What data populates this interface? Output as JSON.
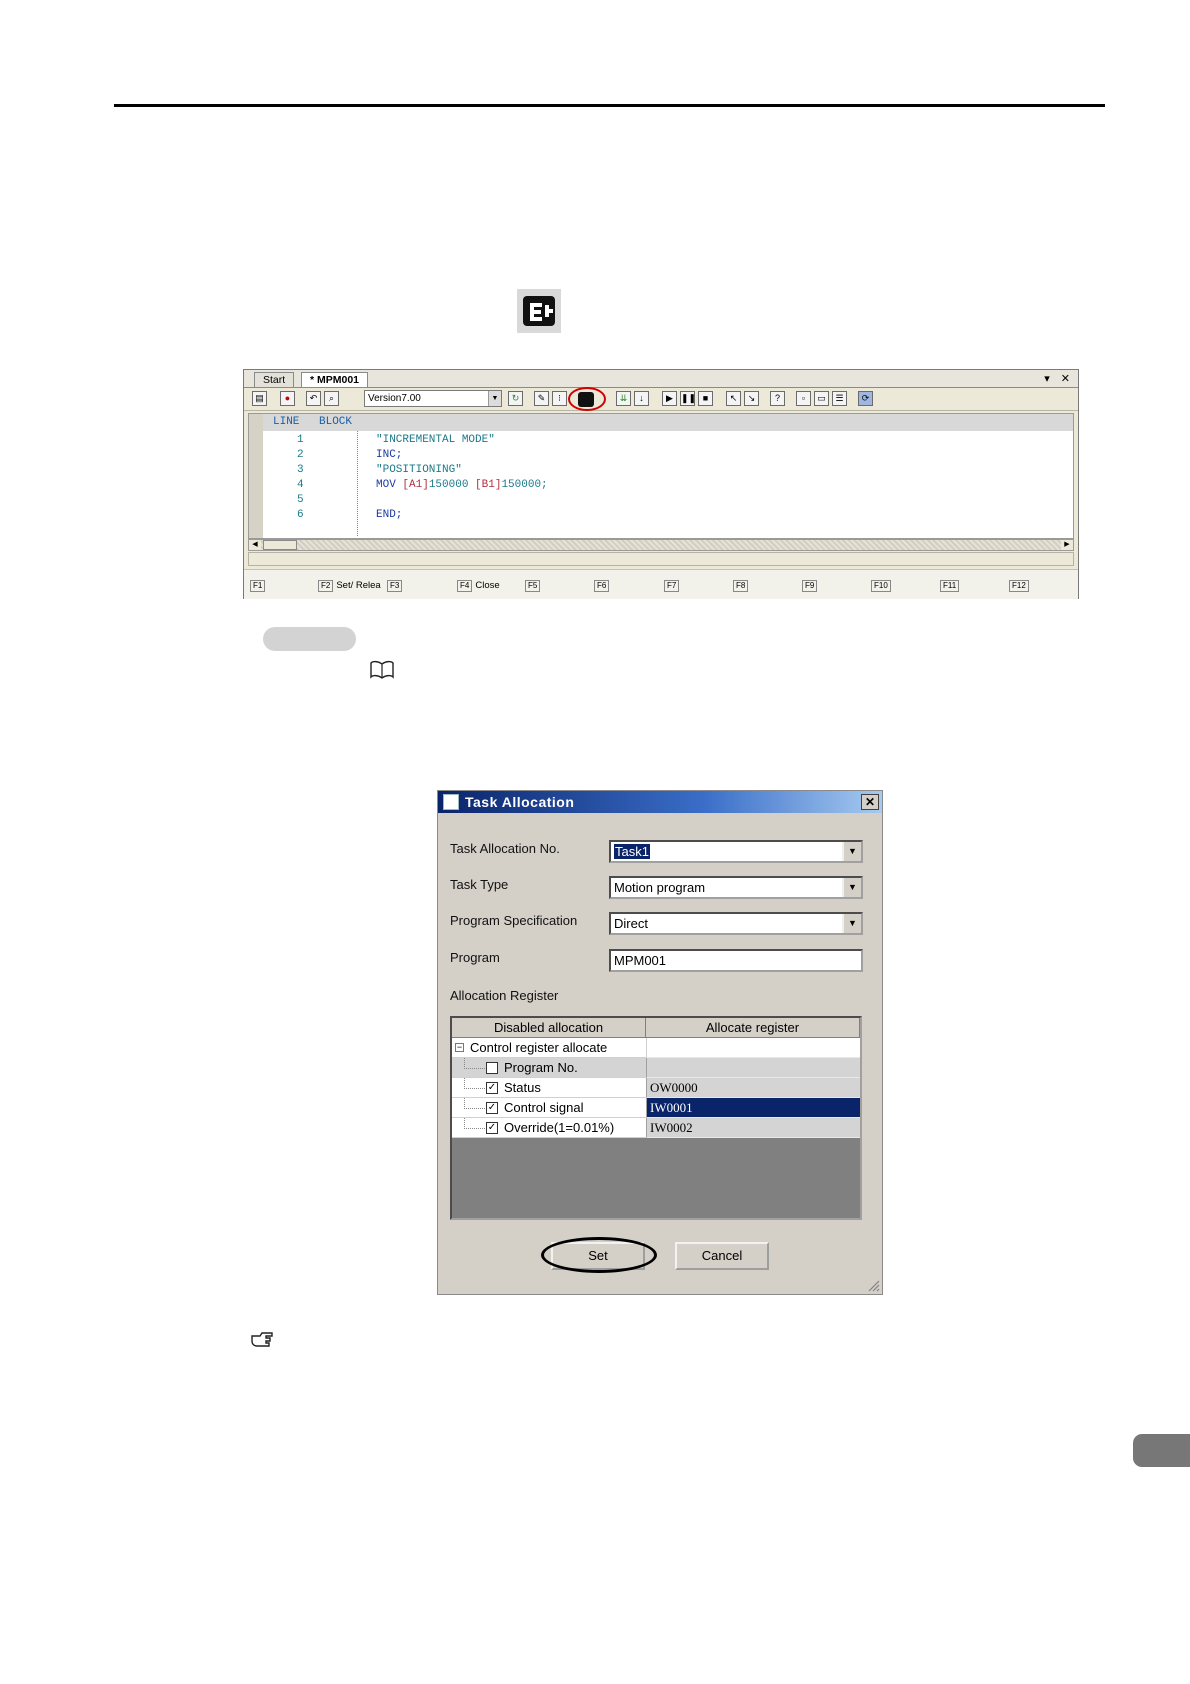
{
  "editor": {
    "tabs": {
      "start": "Start",
      "active": "* MPM001"
    },
    "window_controls": "▾ ✕",
    "version": "Version7.00",
    "code_header": {
      "line": "LINE",
      "block": "BLOCK"
    },
    "lines": [
      {
        "no": "1",
        "text": "\"INCREMENTAL MODE\""
      },
      {
        "no": "2",
        "text": "INC;"
      },
      {
        "no": "3",
        "text": "\"POSITIONING\""
      },
      {
        "no": "4",
        "mov": "MOV",
        "a": "[A1]",
        "av": "150000",
        "b": "[B1]",
        "bv": "150000;"
      },
      {
        "no": "5",
        "text": ""
      },
      {
        "no": "6",
        "text": "END;"
      }
    ],
    "fkeys": [
      {
        "key": "F1",
        "label": ""
      },
      {
        "key": "F2",
        "label": "Set/ Relea"
      },
      {
        "key": "F3",
        "label": ""
      },
      {
        "key": "F4",
        "label": "Close"
      },
      {
        "key": "F5",
        "label": ""
      },
      {
        "key": "F6",
        "label": ""
      },
      {
        "key": "F7",
        "label": ""
      },
      {
        "key": "F8",
        "label": ""
      },
      {
        "key": "F9",
        "label": ""
      },
      {
        "key": "F10",
        "label": ""
      },
      {
        "key": "F11",
        "label": ""
      },
      {
        "key": "F12",
        "label": ""
      }
    ]
  },
  "dialog": {
    "title": "Task  Allocation",
    "close": "✕",
    "fields": {
      "task_no_label": "Task Allocation No.",
      "task_no_value": "Task1",
      "task_type_label": "Task Type",
      "task_type_value": "Motion program",
      "spec_label": "Program Specification",
      "spec_value": "Direct",
      "program_label": "Program",
      "program_value": "MPM001"
    },
    "alloc_label": "Allocation Register",
    "table": {
      "headers": [
        "Disabled allocation",
        "Allocate register"
      ],
      "group": "Control register allocate",
      "rows": [
        {
          "name": "Program No.",
          "checked": false,
          "register": ""
        },
        {
          "name": "Status",
          "checked": true,
          "register": "OW0000"
        },
        {
          "name": "Control signal",
          "checked": true,
          "register": "IW0001",
          "selected": true
        },
        {
          "name": "Override(1=0.01%)",
          "checked": true,
          "register": "IW0002"
        }
      ]
    },
    "buttons": {
      "set": "Set",
      "cancel": "Cancel"
    }
  },
  "icons": {
    "task_button": "task-allocation-icon",
    "reference": "book-icon",
    "note": "pointing-hand-icon"
  },
  "colors": {
    "title_bar": "#0a246a",
    "selection": "#0a246a",
    "highlight_ring": "#d20000"
  }
}
